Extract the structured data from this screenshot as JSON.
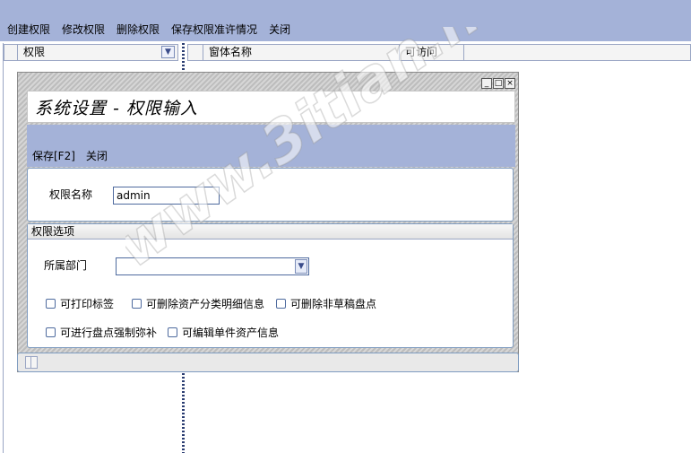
{
  "menu": {
    "create": "创建权限",
    "modify": "修改权限",
    "delete": "删除权限",
    "save_permit": "保存权限准许情况",
    "close": "关闭"
  },
  "left_panel": {
    "header": "权限"
  },
  "right_panel": {
    "col1": "窗体名称",
    "col2": "可访问"
  },
  "dialog": {
    "title": "系统设置 - 权限输入",
    "save": "保存[F2]",
    "close": "关闭",
    "perm_name_label": "权限名称",
    "perm_name_value": "admin",
    "options_header": "权限选项",
    "dept_label": "所属部门",
    "dept_value": "",
    "checkboxes": [
      "可打印标签",
      "可删除资产分类明细信息",
      "可删除非草稿盘点",
      "可进行盘点强制弥补",
      "可编辑单件资产信息"
    ]
  },
  "watermark": "www.3itian.net"
}
